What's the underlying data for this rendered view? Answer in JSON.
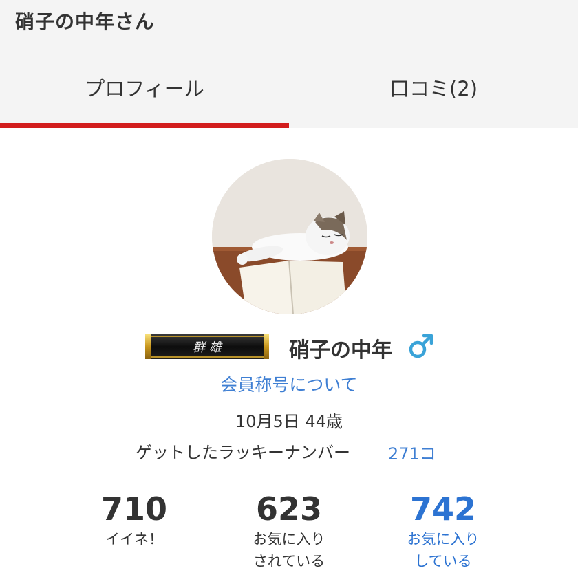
{
  "header": {
    "title": "硝子の中年さん"
  },
  "tabs": [
    {
      "label": "プロフィール",
      "active": true
    },
    {
      "label": "口コミ(2)",
      "active": false
    }
  ],
  "profile": {
    "badge_text": "群 雄",
    "name": "硝子の中年",
    "gender_icon": "male-symbol-icon",
    "rank_link": "会員称号について",
    "birthday": "10月5日 44歳",
    "lucky_label": "ゲットしたラッキーナンバー",
    "lucky_value": "271コ"
  },
  "stats": [
    {
      "value": "710",
      "label_line1": "イイネ！",
      "label_line2": ""
    },
    {
      "value": "623",
      "label_line1": "お気に入り",
      "label_line2": "されている"
    },
    {
      "value": "742",
      "label_line1": "お気に入り",
      "label_line2": "している"
    }
  ],
  "colors": {
    "accent_red": "#d21d1d",
    "link_blue": "#3f7fd3",
    "male_icon": "#3aa3d8"
  }
}
